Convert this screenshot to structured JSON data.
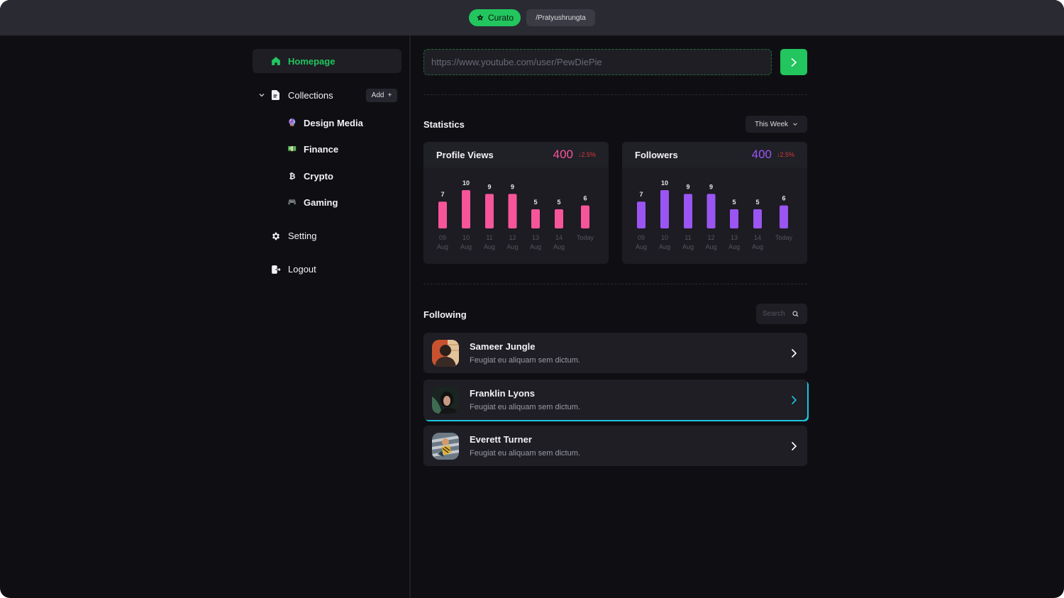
{
  "topbar": {
    "brand_label": "Curato",
    "user_handle": "/Pratyushrungta"
  },
  "sidebar": {
    "home_label": "Homepage",
    "collections_label": "Collections",
    "add_label": "Add",
    "collections": [
      {
        "icon": "crystal-ball-icon",
        "emoji": "🔮",
        "label": "Design Media"
      },
      {
        "icon": "money-icon",
        "emoji": "💵",
        "label": "Finance"
      },
      {
        "icon": "bitcoin-icon",
        "emoji": "₿",
        "label": "Crypto"
      },
      {
        "icon": "gamepad-icon",
        "emoji": "🎮",
        "label": "Gaming"
      }
    ],
    "setting_label": "Setting",
    "logout_label": "Logout"
  },
  "url_bar": {
    "placeholder": "https://www.youtube.com/user/PewDiePie",
    "value": ""
  },
  "statistics": {
    "title": "Statistics",
    "period": "This Week",
    "cards": [
      {
        "title": "Profile Views",
        "value": "400",
        "delta": "↓2.5%",
        "color": "#f7559a"
      },
      {
        "title": "Followers",
        "value": "400",
        "delta": "↓2.5%",
        "color": "#9b55f2"
      }
    ]
  },
  "chart_data": [
    {
      "type": "bar",
      "title": "Profile Views",
      "categories": [
        "09 Aug",
        "10 Aug",
        "11 Aug",
        "12 Aug",
        "13 Aug",
        "14 Aug",
        "Today"
      ],
      "values": [
        7,
        10,
        9,
        9,
        5,
        5,
        6
      ],
      "xlabel": "",
      "ylabel": "",
      "ylim": [
        0,
        10
      ],
      "grid": false,
      "color": "#f7559a"
    },
    {
      "type": "bar",
      "title": "Followers",
      "categories": [
        "09 Aug",
        "10 Aug",
        "11 Aug",
        "12 Aug",
        "13 Aug",
        "14 Aug",
        "Today"
      ],
      "values": [
        7,
        10,
        9,
        9,
        5,
        5,
        6
      ],
      "xlabel": "",
      "ylabel": "",
      "ylim": [
        0,
        10
      ],
      "grid": false,
      "color": "#9b55f2"
    }
  ],
  "following": {
    "title": "Following",
    "search_placeholder": "Search",
    "items": [
      {
        "name": "Sameer Jungle",
        "subtitle": "Feugiat eu aliquam sem dictum.",
        "active": false
      },
      {
        "name": "Franklin Lyons",
        "subtitle": "Feugiat eu aliquam sem dictum.",
        "active": true
      },
      {
        "name": "Everett Turner",
        "subtitle": "Feugiat eu aliquam sem dictum.",
        "active": false
      }
    ]
  },
  "colors": {
    "accent": "#22c55e",
    "highlight": "#1fc3e0",
    "negative": "#d63a3a"
  }
}
